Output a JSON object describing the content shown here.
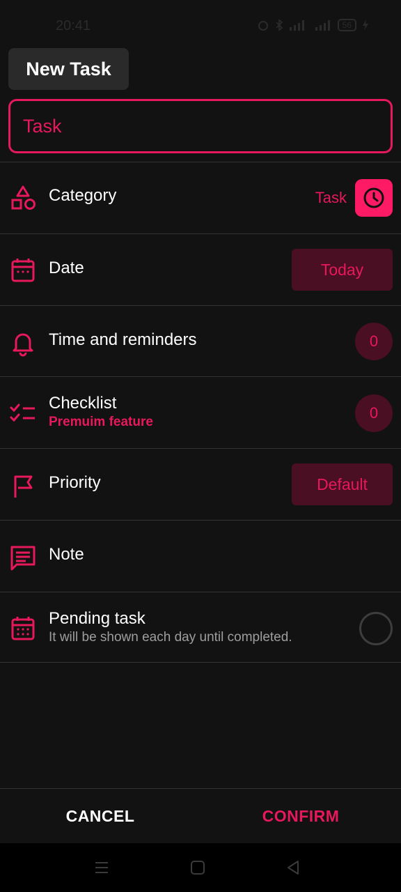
{
  "status_bar": {
    "time": "20:41",
    "battery": "56"
  },
  "header": {
    "title": "New Task"
  },
  "task_input": {
    "placeholder": "Task",
    "value": ""
  },
  "rows": {
    "category": {
      "label": "Category",
      "value": "Task",
      "icon": "shapes-icon"
    },
    "date": {
      "label": "Date",
      "value": "Today",
      "icon": "calendar-icon"
    },
    "time": {
      "label": "Time and reminders",
      "count": "0",
      "icon": "bell-icon"
    },
    "checklist": {
      "label": "Checklist",
      "sub": "Premuim feature",
      "count": "0",
      "icon": "checklist-icon"
    },
    "priority": {
      "label": "Priority",
      "value": "Default",
      "icon": "flag-icon"
    },
    "note": {
      "label": "Note",
      "icon": "note-icon"
    },
    "pending": {
      "label": "Pending task",
      "sub": "It will be shown each day until completed.",
      "icon": "calendar-grid-icon"
    }
  },
  "actions": {
    "cancel": "CANCEL",
    "confirm": "CONFIRM"
  },
  "colors": {
    "accent": "#e8185c",
    "accent_dark": "#4a0f22",
    "background": "#121212"
  }
}
